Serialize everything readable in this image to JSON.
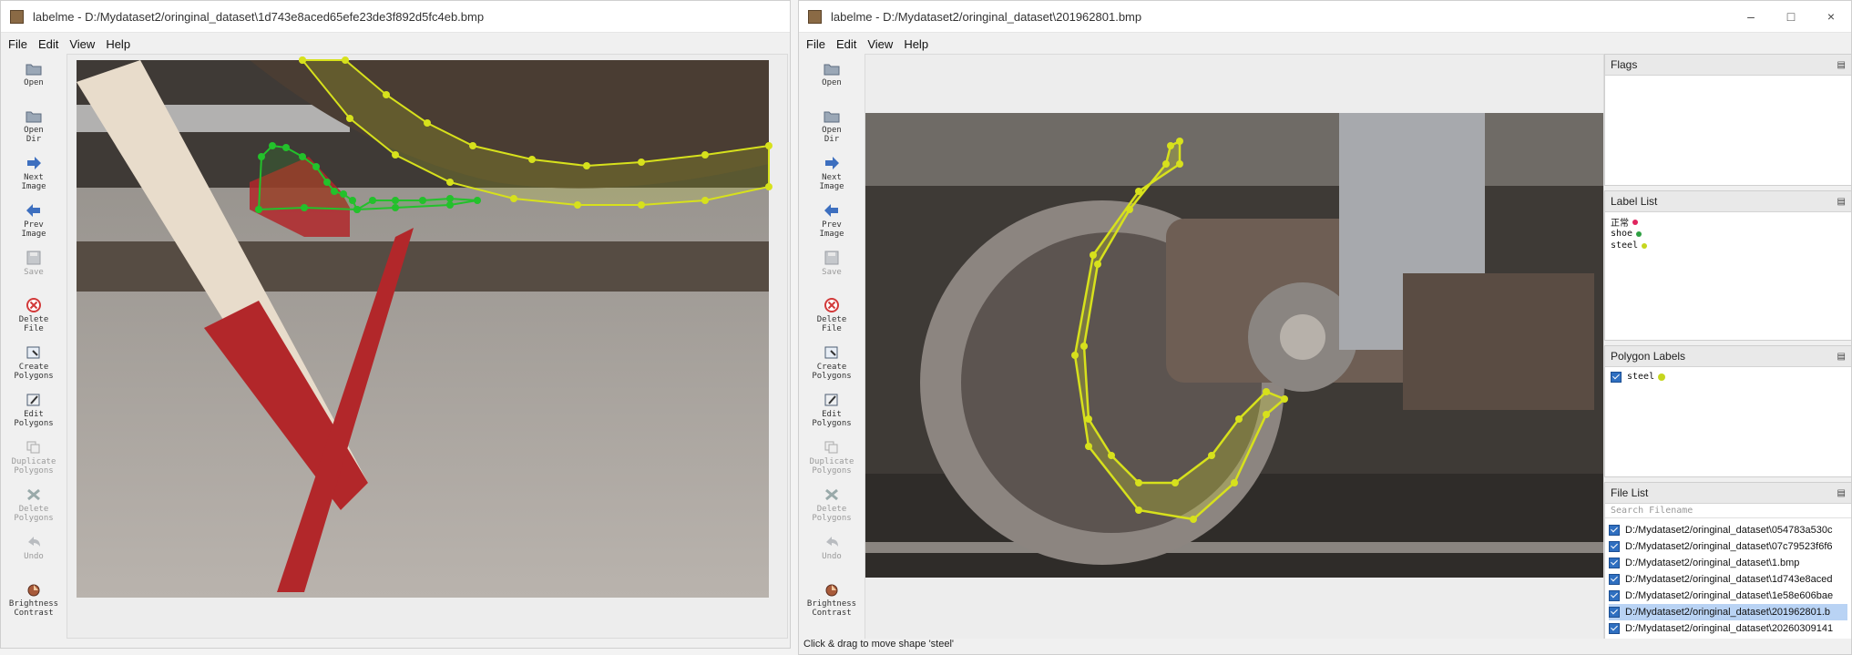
{
  "left": {
    "title": "labelme - D:/Mydataset2/oringinal_dataset\\1d743e8aced65efe23de3f892d5fc4eb.bmp",
    "menu": [
      "File",
      "Edit",
      "View",
      "Help"
    ],
    "tools": [
      {
        "label": "Open",
        "icon": "folder-open-icon",
        "enabled": true
      },
      {
        "label": "Open\nDir",
        "icon": "folder-open-icon",
        "enabled": true
      },
      {
        "label": "Next\nImage",
        "icon": "arrow-right-icon",
        "enabled": true
      },
      {
        "label": "Prev\nImage",
        "icon": "arrow-left-icon",
        "enabled": true
      },
      {
        "label": "Save",
        "icon": "save-icon",
        "enabled": false
      },
      {
        "label": "Delete\nFile",
        "icon": "delete-icon",
        "enabled": true
      },
      {
        "label": "Create\nPolygons",
        "icon": "create-polygon-icon",
        "enabled": true
      },
      {
        "label": "Edit\nPolygons",
        "icon": "edit-icon",
        "enabled": true
      },
      {
        "label": "Duplicate\nPolygons",
        "icon": "duplicate-icon",
        "enabled": false
      },
      {
        "label": "Delete\nPolygons",
        "icon": "delete-polygon-icon",
        "enabled": false
      },
      {
        "label": "Undo",
        "icon": "undo-icon",
        "enabled": false
      },
      {
        "label": "Brightness\nContrast",
        "icon": "brightness-icon",
        "enabled": true
      }
    ]
  },
  "right": {
    "title": "labelme - D:/Mydataset2/oringinal_dataset\\201962801.bmp",
    "menu": [
      "File",
      "Edit",
      "View",
      "Help"
    ],
    "window_controls": [
      "–",
      "□",
      "×"
    ],
    "tools": [
      {
        "label": "Open",
        "icon": "folder-open-icon",
        "enabled": true
      },
      {
        "label": "Open\nDir",
        "icon": "folder-open-icon",
        "enabled": true
      },
      {
        "label": "Next\nImage",
        "icon": "arrow-right-icon",
        "enabled": true
      },
      {
        "label": "Prev\nImage",
        "icon": "arrow-left-icon",
        "enabled": true
      },
      {
        "label": "Save",
        "icon": "save-icon",
        "enabled": false
      },
      {
        "label": "Delete\nFile",
        "icon": "delete-icon",
        "enabled": true
      },
      {
        "label": "Create\nPolygons",
        "icon": "create-polygon-icon",
        "enabled": true
      },
      {
        "label": "Edit\nPolygons",
        "icon": "edit-icon",
        "enabled": true
      },
      {
        "label": "Duplicate\nPolygons",
        "icon": "duplicate-icon",
        "enabled": false
      },
      {
        "label": "Delete\nPolygons",
        "icon": "delete-polygon-icon",
        "enabled": false
      },
      {
        "label": "Undo",
        "icon": "undo-icon",
        "enabled": false
      },
      {
        "label": "Brightness\nContrast",
        "icon": "brightness-icon",
        "enabled": true
      }
    ],
    "docks": {
      "flags": {
        "title": "Flags"
      },
      "label_list": {
        "title": "Label List",
        "items": [
          {
            "text": "正常",
            "color": "#e0245e"
          },
          {
            "text": "shoe",
            "color": "#2ea043"
          },
          {
            "text": "steel",
            "color": "#c6d61e"
          }
        ]
      },
      "polygon_labels": {
        "title": "Polygon Labels",
        "items": [
          {
            "text": "steel",
            "color": "#c6d61e"
          }
        ]
      },
      "file_list": {
        "title": "File List",
        "search_placeholder": "Search Filename",
        "items": [
          "D:/Mydataset2/oringinal_dataset\\054783a530c",
          "D:/Mydataset2/oringinal_dataset\\07c79523f6f6",
          "D:/Mydataset2/oringinal_dataset\\1.bmp",
          "D:/Mydataset2/oringinal_dataset\\1d743e8aced",
          "D:/Mydataset2/oringinal_dataset\\1e58e606bae",
          "D:/Mydataset2/oringinal_dataset\\201962801.b",
          "D:/Mydataset2/oringinal_dataset\\20260309141"
        ],
        "selected_index": 5
      }
    },
    "status": "Click & drag to move shape 'steel'"
  },
  "colors": {
    "shape_yellow": "#d7e11c",
    "shape_green": "#23c12b",
    "selection": "#b9d3f4"
  }
}
